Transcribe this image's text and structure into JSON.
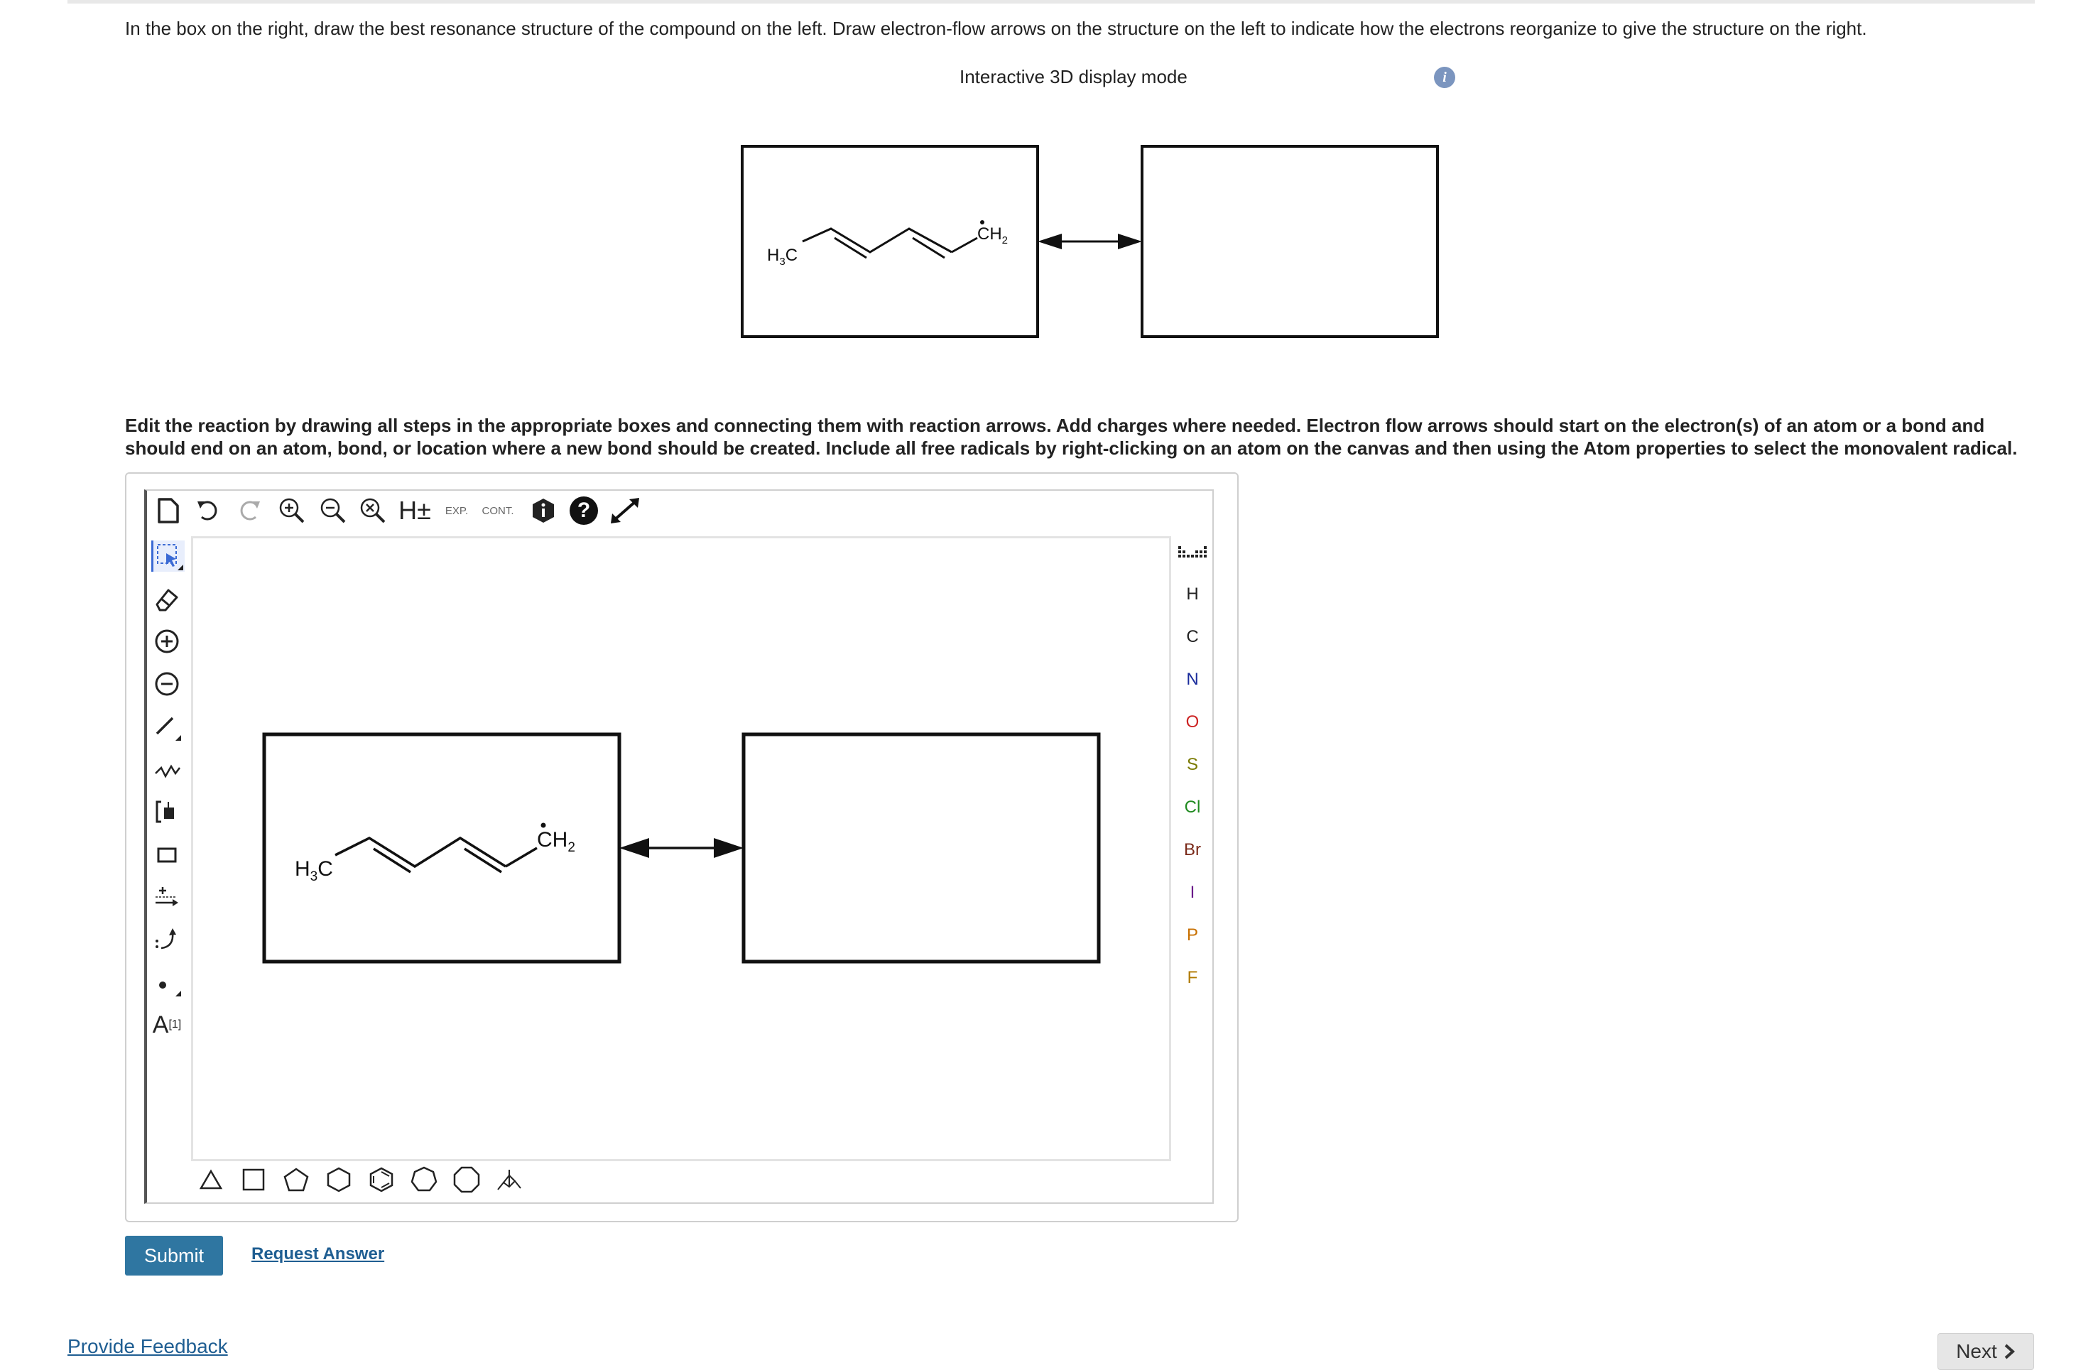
{
  "instructions": {
    "top": "In the box on the right, draw the best resonance structure of the compound on the left. Draw electron-flow arrows on the structure on the left to indicate how the electrons reorganize to give the structure on the right.",
    "editor": "Edit the reaction by drawing all steps in the appropriate boxes and connecting them with reaction arrows. Add charges where needed. Electron flow arrows should start on the electron(s) of an atom or a bond and should end on an atom, bond, or location where a new bond should be created. Include all free radicals by right-clicking on an atom on the canvas and then using the Atom properties to select the monovalent radical."
  },
  "display_mode": {
    "label": "Interactive 3D display mode",
    "info_icon": "info-icon",
    "info_glyph": "i"
  },
  "molecule": {
    "left_group": "H₃C",
    "left_main": "H",
    "left_sub": "3",
    "left_tail": "C",
    "right_group": "ẆCH₂",
    "right_main": "CH",
    "right_sub": "2"
  },
  "toolbar": {
    "items": [
      "new-document-icon",
      "undo-icon",
      "redo-icon",
      "zoom-in-icon",
      "zoom-out-icon",
      "zoom-reset-icon",
      "hydrogen-toggle-icon",
      "expand-icon",
      "contract-icon",
      "info-3d-icon",
      "help-icon",
      "fullscreen-icon"
    ],
    "h_label": "H±",
    "exp_label": "EXP.",
    "cont_label": "CONT.",
    "help_label": "?"
  },
  "left_tools": [
    "select-lasso-icon",
    "eraser-icon",
    "charge-plus-icon",
    "charge-minus-icon",
    "bond-single-icon",
    "chain-icon",
    "bracket-icon",
    "rectangle-shape-icon",
    "reaction-arrow-icon",
    "electron-flow-arrow-icon",
    "radical-dot-icon",
    "atom-label-icon"
  ],
  "atom_label_tool": {
    "letter": "A",
    "index": "[1]"
  },
  "atoms": [
    {
      "symbol": "H",
      "color": "#222222"
    },
    {
      "symbol": "C",
      "color": "#222222"
    },
    {
      "symbol": "N",
      "color": "#1a2c9c"
    },
    {
      "symbol": "O",
      "color": "#cc2222"
    },
    {
      "symbol": "S",
      "color": "#7a7a00"
    },
    {
      "symbol": "Cl",
      "color": "#1f8a1f"
    },
    {
      "symbol": "Br",
      "color": "#7a2a1a"
    },
    {
      "symbol": "I",
      "color": "#6a1a8a"
    },
    {
      "symbol": "P",
      "color": "#c87000"
    },
    {
      "symbol": "F",
      "color": "#b07a00"
    }
  ],
  "shapes": [
    "triangle-icon",
    "square-icon",
    "pentagon-icon",
    "hexagon-icon",
    "benzene-icon",
    "heptagon-icon",
    "octagon-icon",
    "chair-conformation-icon"
  ],
  "buttons": {
    "submit": "Submit",
    "request_answer": "Request Answer",
    "provide_feedback": "Provide Feedback",
    "next": "Next"
  },
  "colors": {
    "accent": "#2f76a1",
    "link": "#1f5e92",
    "info": "#7b95bf"
  }
}
